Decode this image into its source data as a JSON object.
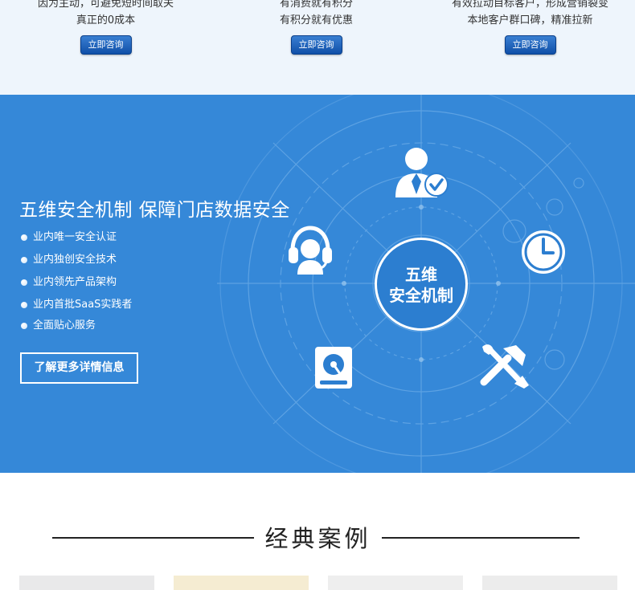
{
  "top_columns": [
    {
      "line1": "因为主动，可避免短时间取关",
      "line2": "真正的0成本",
      "button": "立即咨询"
    },
    {
      "line1": "有消费就有积分",
      "line2": "有积分就有优惠",
      "button": "立即咨询"
    },
    {
      "line1": "有效拉动目标客户，形成营销裂变",
      "line2": "本地客户群口碑，精准拉新",
      "button": "立即咨询"
    }
  ],
  "security": {
    "title": "五维安全机制  保障门店数据安全",
    "features": [
      "业内唯一安全认证",
      "业内独创安全技术",
      "业内领先产品架构",
      "业内首批SaaS实践者",
      "全面贴心服务"
    ],
    "more_button": "了解更多详情信息",
    "center_line1": "五维",
    "center_line2": "安全机制",
    "icons": [
      "user-check-icon",
      "headset-icon",
      "clock-icon",
      "hard-drive-icon",
      "tools-icon"
    ]
  },
  "cases": {
    "title": "经典案例"
  },
  "colors": {
    "band_blue": "#3588d8",
    "top_bg": "#eef5fc",
    "button_blue": "#0f4fa8"
  }
}
